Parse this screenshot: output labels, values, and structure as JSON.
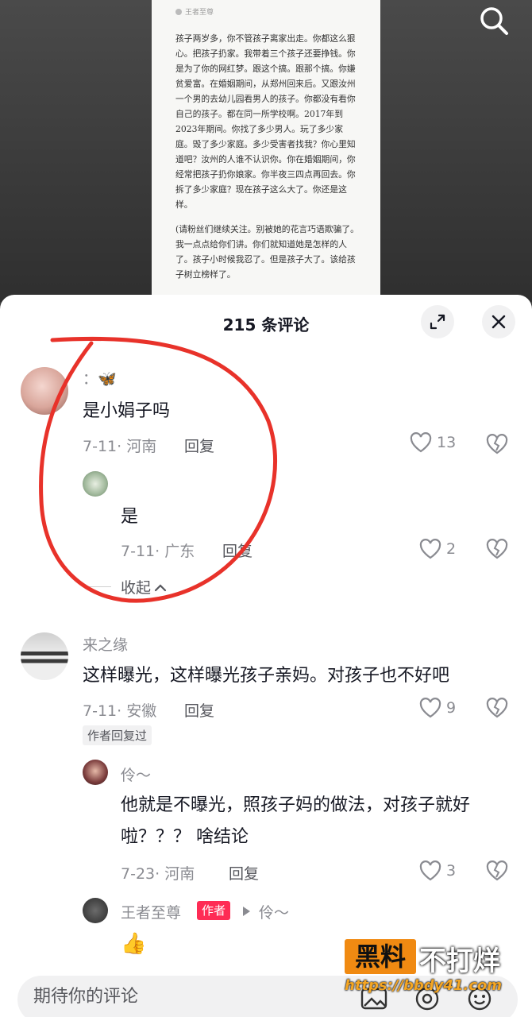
{
  "doc": {
    "header": "王者至尊",
    "body": "孩子两岁多，你不管孩子离家出走。你都这么狠心。把孩子扔家。我带着三个孩子还要挣钱。你是为了你的网红梦。跟这个搞。跟那个搞。你嫌贫爱富。在婚姻期间，从郑州回来后。又跟汝州一个男的去幼儿园看男人的孩子。你都没有看你自己的孩子。都在同一所学校啊。2017年到2023年期间。你找了多少男人。玩了多少家庭。毁了多少家庭。多少受害者找我？你心里知道吧？汝州的人谁不认识你。你在婚姻期间，你经常把孩子扔你娘家。你半夜三四点再回去。你拆了多少家庭？现在孩子这么大了。你还是这样。",
    "note": "(请粉丝们继续关注。别被她的花言巧语欺骗了。我一点点给你们讲。你们就知道她是怎样的人了。孩子小时候我忍了。但是孩子大了。该给孩子树立榜样了。"
  },
  "panel": {
    "title": "215 条评论"
  },
  "comments": [
    {
      "user": "：🦋",
      "text": "是小娟子吗",
      "meta": "7-11· 河南",
      "reply": "回复",
      "likes": "13"
    },
    {
      "user": "",
      "text": "是",
      "meta": "7-11· 广东",
      "reply": "回复",
      "likes": "2"
    },
    {
      "user": "来之缘",
      "text": "这样曝光，这样曝光孩子亲妈。对孩子也不好吧",
      "meta": "7-11· 安徽",
      "reply": "回复",
      "likes": "9",
      "badge": "作者回复过"
    },
    {
      "user": "伶～",
      "text": "他就是不曝光，照孩子妈的做法，对孩子就好啦？？？ 啥结论",
      "meta": "7-23· 河南",
      "reply": "回复",
      "likes": "3"
    },
    {
      "user": "王者至尊",
      "author_badge": "作者",
      "reply_to": "伶～",
      "text": "👍"
    }
  ],
  "collapse": "收起",
  "input": {
    "placeholder": "期待你的评论"
  },
  "watermark": {
    "box": "黑料",
    "right": "不打烊",
    "url": "https://bbdy41.com"
  },
  "colors": {
    "accent_red": "#fe2c55",
    "annotation_red": "#e8322a"
  }
}
